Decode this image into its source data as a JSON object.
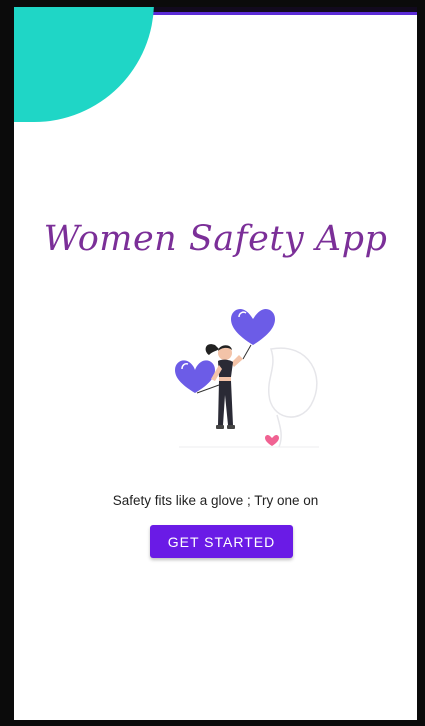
{
  "app": {
    "title": "Women Safety App",
    "tagline": "Safety fits like a glove ; Try one on",
    "cta_label": "GET STARTED"
  },
  "colors": {
    "accent": "#6a1be6",
    "title": "#7b2f98",
    "decor": "#1fd6c6",
    "hearts": "#6c5ce7",
    "small_heart": "#f06292"
  },
  "illustration": {
    "icon": "woman-holding-hearts-illustration"
  }
}
